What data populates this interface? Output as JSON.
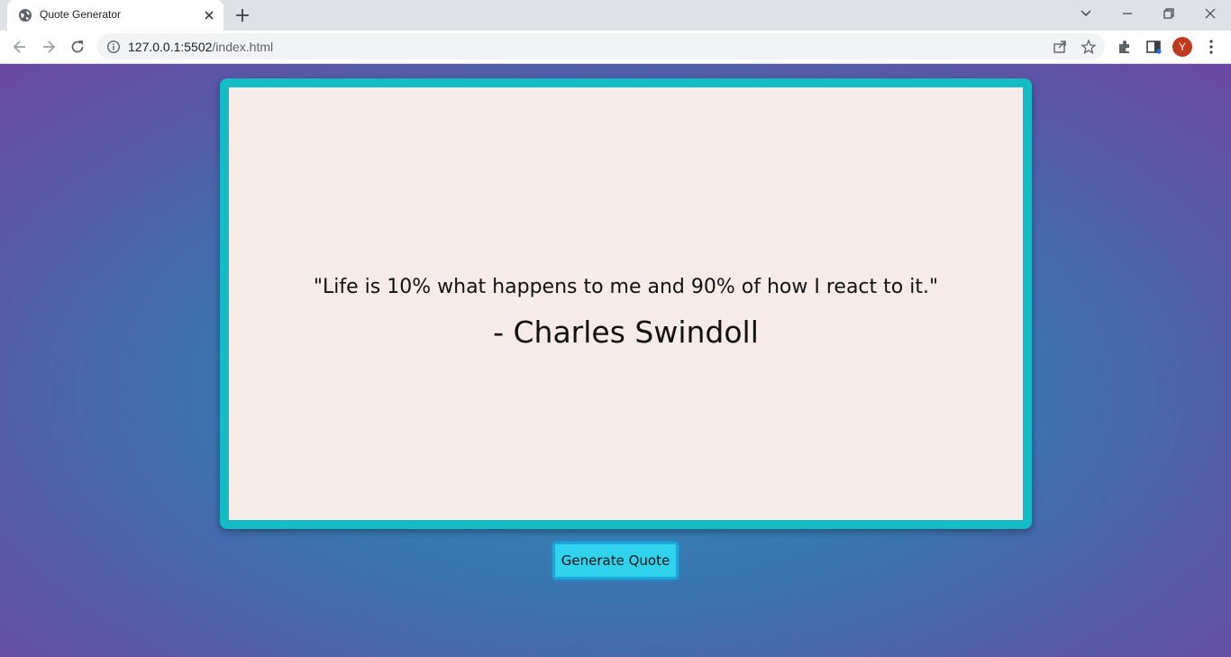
{
  "browser": {
    "tab_title": "Quote Generator",
    "url_host": "127.0.0.1:5502",
    "url_path": "/index.html",
    "profile_initial": "Y"
  },
  "page": {
    "quote": "\"Life is 10% what happens to me and 90% of how I react to it.\"",
    "author": "- Charles Swindoll",
    "button_label": "Generate Quote"
  },
  "colors": {
    "frame": "#14bcc5",
    "card": "#f5ebe8",
    "button": "#30d3ee",
    "background_center": "#2f8fb2",
    "background_edge": "#6a48a3"
  },
  "icons": {
    "favicon": "globe-icon",
    "tab_close": "close-icon",
    "new_tab": "plus-icon",
    "back": "back-arrow-icon",
    "forward": "forward-arrow-icon",
    "reload": "reload-icon",
    "site_info": "info-icon",
    "share": "share-icon",
    "bookmark": "star-icon",
    "extensions": "puzzle-icon",
    "side_panel": "side-panel-icon",
    "menu": "kebab-menu-icon"
  }
}
